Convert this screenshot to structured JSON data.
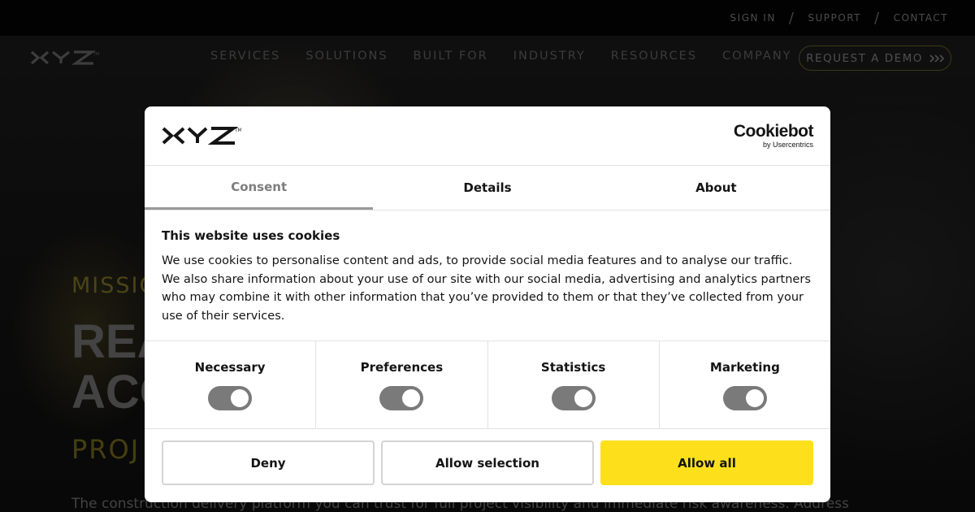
{
  "topbar": {
    "links": [
      "SIGN IN",
      "SUPPORT",
      "CONTACT"
    ],
    "separator": "/"
  },
  "nav": {
    "logo_text": "XYZ",
    "items": [
      "SERVICES",
      "SOLUTIONS",
      "BUILT FOR",
      "INDUSTRY",
      "RESOURCES",
      "COMPANY"
    ],
    "cta_label": "REQUEST A DEMO",
    "cta_icon": "chevrons-right-icon"
  },
  "hero": {
    "kicker": "MISSIO",
    "title_line1": "REA",
    "title_line2": "ACC",
    "subtitle": "PROJ",
    "body": "The construction delivery platform you can trust for full project visibility and immediate risk awareness. Address"
  },
  "dialog": {
    "logo_text": "XYZ",
    "cookiebot_name": "Cookiebot",
    "cookiebot_by": "by Usercentrics",
    "tabs": [
      {
        "label": "Consent",
        "active": true
      },
      {
        "label": "Details",
        "active": false
      },
      {
        "label": "About",
        "active": false
      }
    ],
    "heading": "This website uses cookies",
    "body": "We use cookies to personalise content and ads, to provide social media features and to analyse our traffic. We also share information about your use of our site with our social media, advertising and analytics partners who may combine it with other information that you’ve provided to them or that they’ve collected from your use of their services.",
    "toggles": [
      {
        "label": "Necessary",
        "on": true
      },
      {
        "label": "Preferences",
        "on": true
      },
      {
        "label": "Statistics",
        "on": true
      },
      {
        "label": "Marketing",
        "on": true
      }
    ],
    "buttons": {
      "deny": "Deny",
      "allow_selection": "Allow selection",
      "allow_all": "Allow all"
    }
  },
  "colors": {
    "accent_yellow": "#fde01b",
    "toggle_gray": "#7a7a7a",
    "hero_yellow": "#8a7d2a"
  }
}
